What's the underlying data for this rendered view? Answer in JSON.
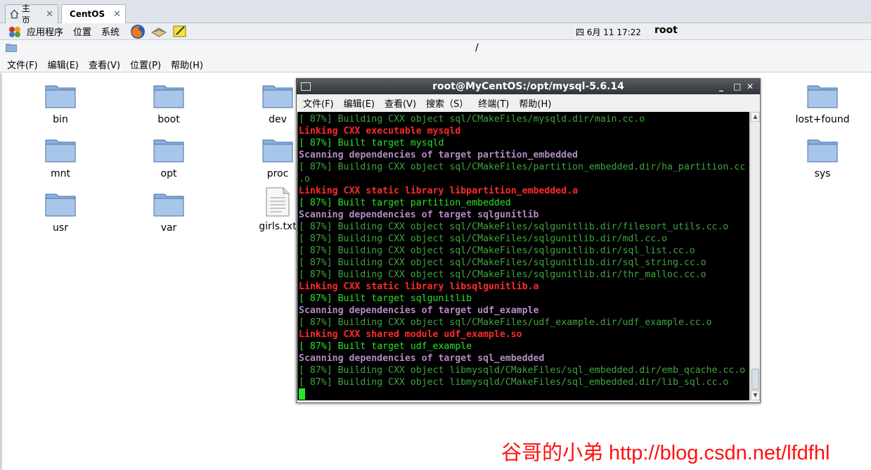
{
  "tabs": [
    {
      "label": "主页",
      "close": "✕"
    },
    {
      "label": "CentOS",
      "close": "✕"
    }
  ],
  "panel": {
    "menus": [
      "应用程序",
      "位置",
      "系统"
    ],
    "clock": "四 6月 11 17:22",
    "user": "root"
  },
  "location": {
    "path": "/"
  },
  "fm_menu": [
    "文件(F)",
    "编辑(E)",
    "查看(V)",
    "位置(P)",
    "帮助(H)"
  ],
  "files": [
    {
      "name": "bin",
      "type": "folder"
    },
    {
      "name": "boot",
      "type": "folder"
    },
    {
      "name": "dev",
      "type": "folder"
    },
    {
      "name": "lost+found",
      "type": "folder"
    },
    {
      "name": "mnt",
      "type": "folder"
    },
    {
      "name": "opt",
      "type": "folder"
    },
    {
      "name": "proc",
      "type": "folder"
    },
    {
      "name": "sys",
      "type": "folder"
    },
    {
      "name": "usr",
      "type": "folder"
    },
    {
      "name": "var",
      "type": "folder"
    },
    {
      "name": "girls.txt",
      "type": "document"
    }
  ],
  "terminal": {
    "title": "root@MyCentOS:/opt/mysql-5.6.14",
    "window_buttons": [
      "_",
      "□",
      "✕"
    ],
    "menu": [
      "文件(F)",
      "编辑(E)",
      "查看(V)",
      "搜索（S）",
      "终端(T)",
      "帮助(H)"
    ],
    "lines": [
      "[ 87%] Building CXX object sql/CMakeFiles/mysqld.dir/main.cc.o",
      "Linking CXX executable mysqld",
      "[ 87%] Built target mysqld",
      "Scanning dependencies of target partition_embedded",
      "[ 87%] Building CXX object sql/CMakeFiles/partition_embedded.dir/ha_partition.cc",
      ".o",
      "Linking CXX static library libpartition_embedded.a",
      "[ 87%] Built target partition_embedded",
      "Scanning dependencies of target sqlgunitlib",
      "[ 87%] Building CXX object sql/CMakeFiles/sqlgunitlib.dir/filesort_utils.cc.o",
      "[ 87%] Building CXX object sql/CMakeFiles/sqlgunitlib.dir/mdl.cc.o",
      "[ 87%] Building CXX object sql/CMakeFiles/sqlgunitlib.dir/sql_list.cc.o",
      "[ 87%] Building CXX object sql/CMakeFiles/sqlgunitlib.dir/sql_string.cc.o",
      "[ 87%] Building CXX object sql/CMakeFiles/sqlgunitlib.dir/thr_malloc.cc.o",
      "Linking CXX static library libsqlgunitlib.a",
      "[ 87%] Built target sqlgunitlib",
      "Scanning dependencies of target udf_example",
      "[ 87%] Building CXX object sql/CMakeFiles/udf_example.dir/udf_example.cc.o",
      "Linking CXX shared module udf_example.so",
      "[ 87%] Built target udf_example",
      "Scanning dependencies of target sql_embedded",
      "[ 87%] Building CXX object libmysqld/CMakeFiles/sql_embedded.dir/emb_qcache.cc.o",
      "[ 87%] Building CXX object libmysqld/CMakeFiles/sql_embedded.dir/lib_sql.cc.o"
    ],
    "line_styles": [
      "g",
      "r",
      "bg",
      "m",
      "g",
      "g",
      "r",
      "bg",
      "m",
      "g",
      "g",
      "g",
      "g",
      "g",
      "r",
      "bg",
      "m",
      "g",
      "r",
      "bg",
      "m",
      "g",
      "g"
    ]
  },
  "watermark": "谷哥的小弟 http://blog.csdn.net/lfdfhl",
  "colors": {
    "building": "#3fa53f",
    "built": "#29e329",
    "linking": "#ff2a2a",
    "scanning": "#b58ac4",
    "watermark": "#ff1010"
  }
}
